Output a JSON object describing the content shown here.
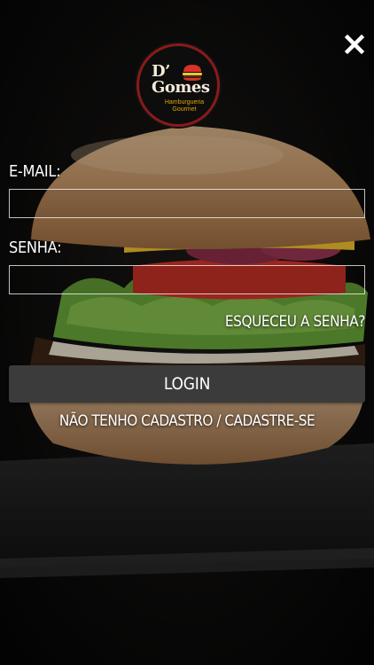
{
  "brand": {
    "name_line1": "D’",
    "name_line2": "Gomes",
    "subtitle_line1": "Hamburgueria",
    "subtitle_line2": "Gourmet",
    "accent_color": "#e0a400",
    "ring_color": "#8a1a1a"
  },
  "form": {
    "email_label": "E-MAIL:",
    "email_value": "",
    "password_label": "SENHA:",
    "password_value": "",
    "forgot_password_label": "ESQUECEU A SENHA?",
    "login_label": "LOGIN",
    "register_label": "NÃO TENHO CADASTRO / CADASTRE-SE"
  },
  "icons": {
    "close": "close-icon",
    "background": "burger-photo"
  },
  "colors": {
    "button_bg": "#3b3b3b",
    "text": "#ffffff"
  }
}
